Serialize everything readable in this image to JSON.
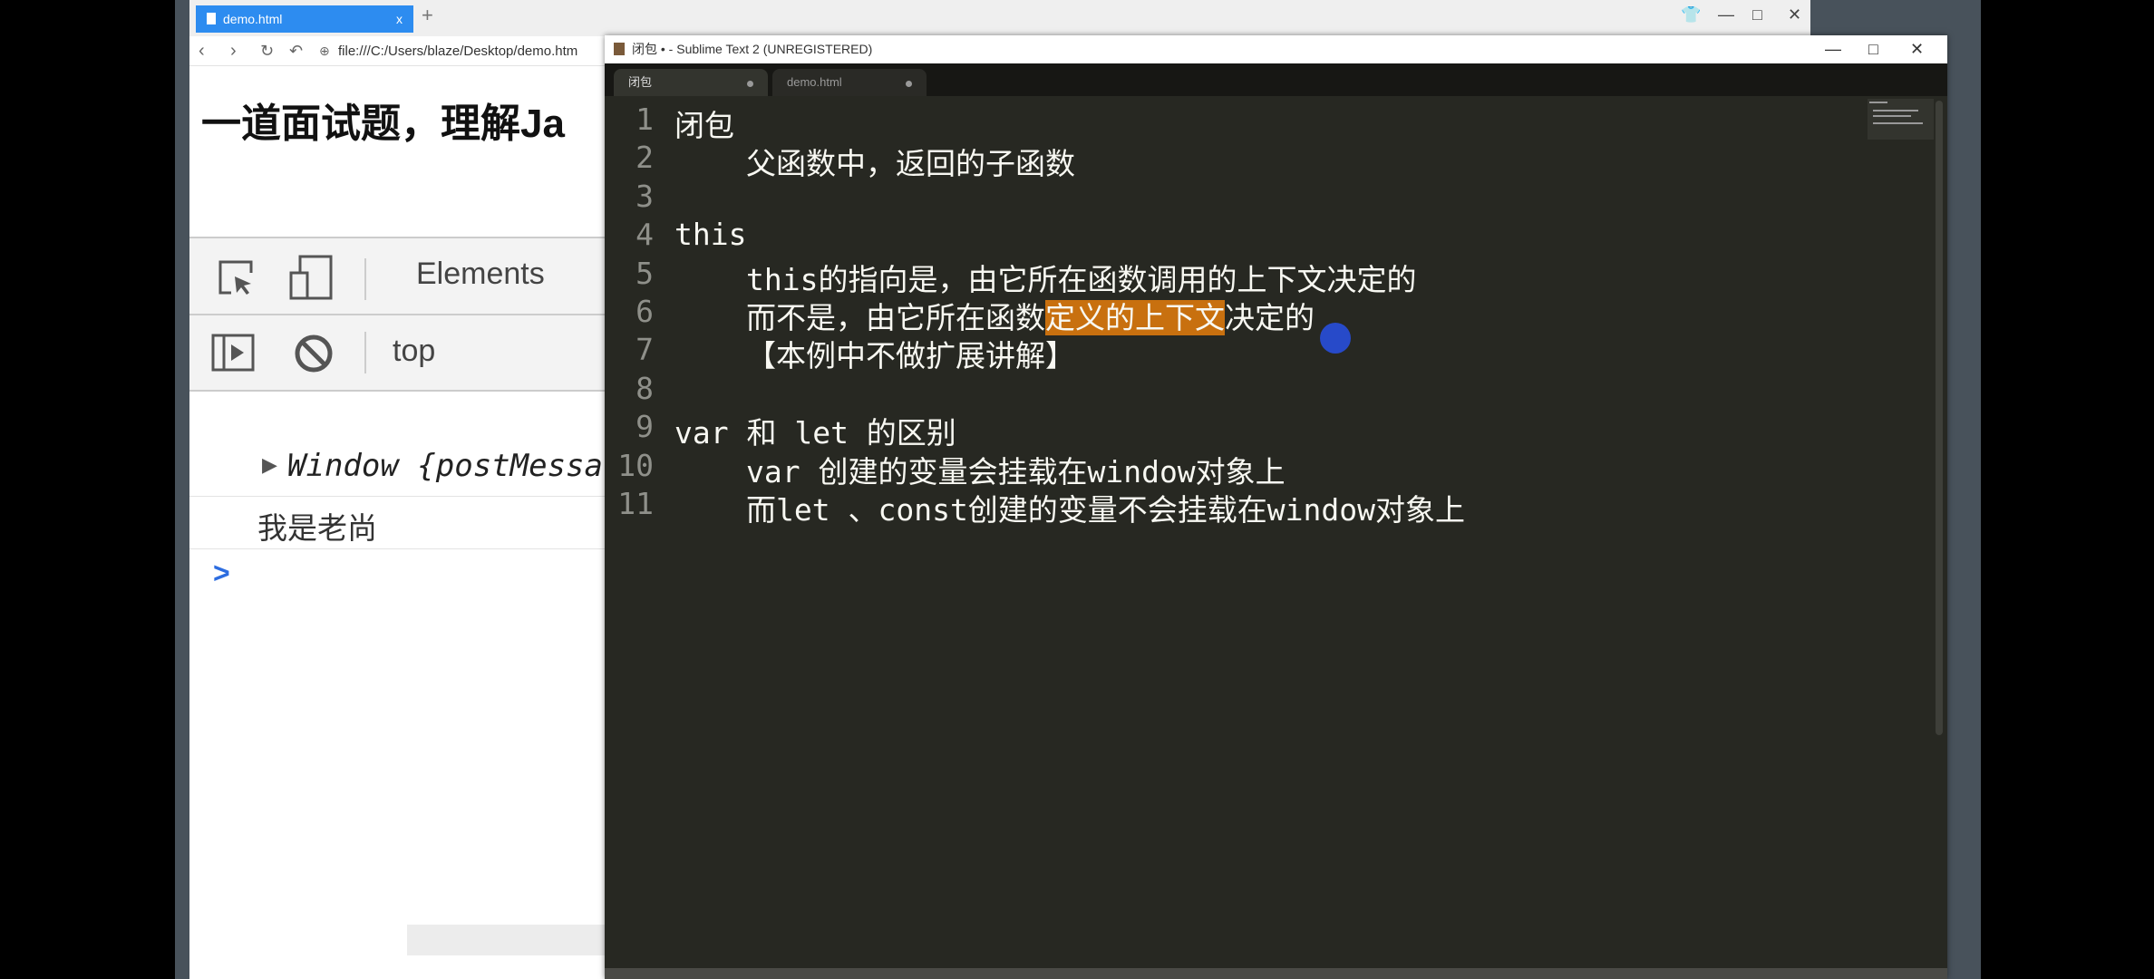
{
  "browser": {
    "tab_title": "demo.html",
    "tab_close": "x",
    "new_tab": "+",
    "address": "file:///C:/Users/blaze/Desktop/demo.htm",
    "page_heading": "一道面试题，理解Ja",
    "window_controls": {
      "skin": "👕",
      "minimize": "—",
      "maximize": "□",
      "close": "✕"
    }
  },
  "devtools": {
    "tab_elements": "Elements",
    "context": "top",
    "console": [
      {
        "text": "Window {postMessa",
        "expandable": true
      },
      {
        "text": "我是老尚",
        "expandable": false
      }
    ],
    "prompt": ">"
  },
  "sublime": {
    "title": "闭包 • - Sublime Text 2 (UNREGISTERED)",
    "window_controls": {
      "minimize": "—",
      "maximize": "□",
      "close": "✕"
    },
    "tabs": [
      {
        "label": "闭包",
        "active": true
      },
      {
        "label": "demo.html",
        "active": false
      }
    ],
    "lines": [
      {
        "n": "1",
        "text": "闭包",
        "indent": false
      },
      {
        "n": "2",
        "text": "父函数中，返回的子函数",
        "indent": true
      },
      {
        "n": "3",
        "text": "",
        "indent": false
      },
      {
        "n": "4",
        "text": "this",
        "indent": false
      },
      {
        "n": "5",
        "text": "this的指向是，由它所在函数调用的上下文决定的",
        "indent": true
      },
      {
        "n": "6",
        "text_before": "而不是，由它所在函数",
        "text_selected": "定义的上下文",
        "text_after": "决定的",
        "indent": true
      },
      {
        "n": "7",
        "text": "【本例中不做扩展讲解】",
        "indent": true
      },
      {
        "n": "8",
        "text": "",
        "indent": false
      },
      {
        "n": "9",
        "text": "var 和 let 的区别",
        "indent": false
      },
      {
        "n": "10",
        "text": "var 创建的变量会挂载在window对象上",
        "indent": true
      },
      {
        "n": "11",
        "text": "而let 、const创建的变量不会挂载在window对象上",
        "indent": true
      }
    ],
    "selection_color": "#c8700f"
  }
}
